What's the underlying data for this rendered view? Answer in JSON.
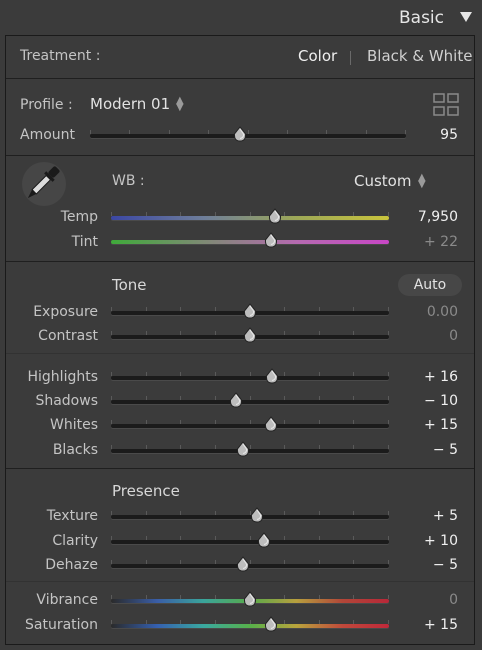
{
  "header": {
    "title": "Basic"
  },
  "treatment": {
    "label": "Treatment :",
    "options": [
      "Color",
      "Black & White"
    ],
    "selected": "Color"
  },
  "profile": {
    "label": "Profile :",
    "value": "Modern 01"
  },
  "amount": {
    "label": "Amount",
    "value": "95",
    "pct": 0.475
  },
  "wb": {
    "label": "WB :",
    "value": "Custom"
  },
  "temp": {
    "label": "Temp",
    "value": "7,950",
    "pct": 0.59
  },
  "tint": {
    "label": "Tint",
    "value": "+ 22",
    "pct": 0.575
  },
  "tone": {
    "title": "Tone",
    "auto": "Auto",
    "sliders": [
      {
        "id": "exposure",
        "label": "Exposure",
        "value": "0.00",
        "pct": 0.5,
        "dim": true
      },
      {
        "id": "contrast",
        "label": "Contrast",
        "value": "0",
        "pct": 0.5,
        "dim": true
      },
      {
        "id": "highlights",
        "label": "Highlights",
        "value": "+ 16",
        "pct": 0.58,
        "dim": false
      },
      {
        "id": "shadows",
        "label": "Shadows",
        "value": "− 10",
        "pct": 0.45,
        "dim": false
      },
      {
        "id": "whites",
        "label": "Whites",
        "value": "+ 15",
        "pct": 0.575,
        "dim": false
      },
      {
        "id": "blacks",
        "label": "Blacks",
        "value": "− 5",
        "pct": 0.475,
        "dim": false
      }
    ]
  },
  "presence": {
    "title": "Presence",
    "sliders": [
      {
        "id": "texture",
        "label": "Texture",
        "value": "+ 5",
        "pct": 0.525,
        "dim": false
      },
      {
        "id": "clarity",
        "label": "Clarity",
        "value": "+ 10",
        "pct": 0.55,
        "dim": false
      },
      {
        "id": "dehaze",
        "label": "Dehaze",
        "value": "− 5",
        "pct": 0.475,
        "dim": false
      },
      {
        "id": "vibrance",
        "label": "Vibrance",
        "value": "0",
        "pct": 0.5,
        "dim": true
      },
      {
        "id": "saturation",
        "label": "Saturation",
        "value": "+ 15",
        "pct": 0.575,
        "dim": false
      }
    ]
  },
  "icons": {
    "header_toggle": "triangle-down-icon",
    "profile_stepper": "up-down-arrows-icon",
    "profile_browser": "grid-icon",
    "wb_selector": "eyedropper-icon",
    "wb_stepper": "up-down-arrows-icon"
  },
  "colors": {
    "panel_bg": "#3b3b3b",
    "divider": "#1f1f1f",
    "bright_text": "#f0f0f0",
    "dim_text": "#8a8a8a"
  }
}
